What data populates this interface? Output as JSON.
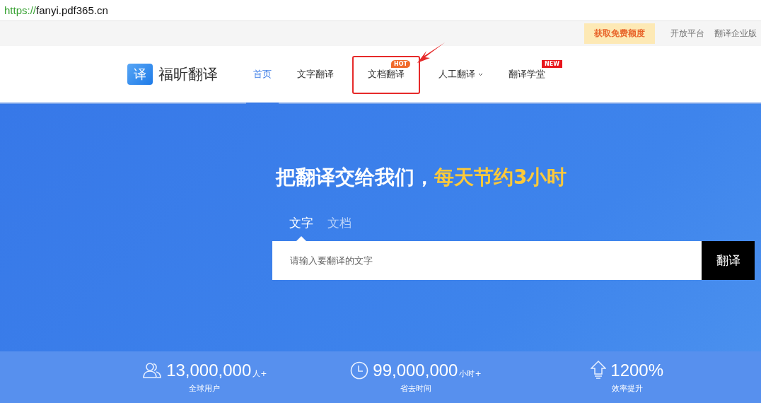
{
  "address_bar": {
    "scheme": "https://",
    "host": "fanyi.pdf365.cn"
  },
  "top_links": [
    {
      "label": "获取免费额度",
      "kind": "promo"
    },
    {
      "label": "开放平台",
      "kind": "link"
    },
    {
      "label": "翻译企业版",
      "kind": "link"
    }
  ],
  "logo": {
    "glyph": "译",
    "name": "福昕翻译"
  },
  "nav": [
    {
      "label": "首页",
      "selected": true
    },
    {
      "label": "文字翻译",
      "selected": false
    },
    {
      "label": "文档翻译",
      "selected": false,
      "highlighted": true,
      "badge": {
        "text": "HOT",
        "kind": "hot"
      }
    },
    {
      "label": "人工翻译",
      "selected": false,
      "dropdown": true
    },
    {
      "label": "翻译学堂",
      "selected": false,
      "badge": {
        "text": "NEW",
        "kind": "new"
      }
    }
  ],
  "hero": {
    "title": "把翻译交给我们，",
    "title_accent": "每天节约3小时",
    "tabs": [
      {
        "label": "文字",
        "selected": true
      },
      {
        "label": "文档",
        "selected": false
      }
    ],
    "input": {
      "placeholder": "请输入要翻译的文字"
    },
    "button": "翻译"
  },
  "stats": [
    {
      "value": "13,000,000",
      "unit": "人+",
      "label": "全球用户"
    },
    {
      "value": "99,000,000",
      "unit": "小时+",
      "label": "省去时间"
    },
    {
      "value": "1200%",
      "label": "效率提升"
    }
  ]
}
